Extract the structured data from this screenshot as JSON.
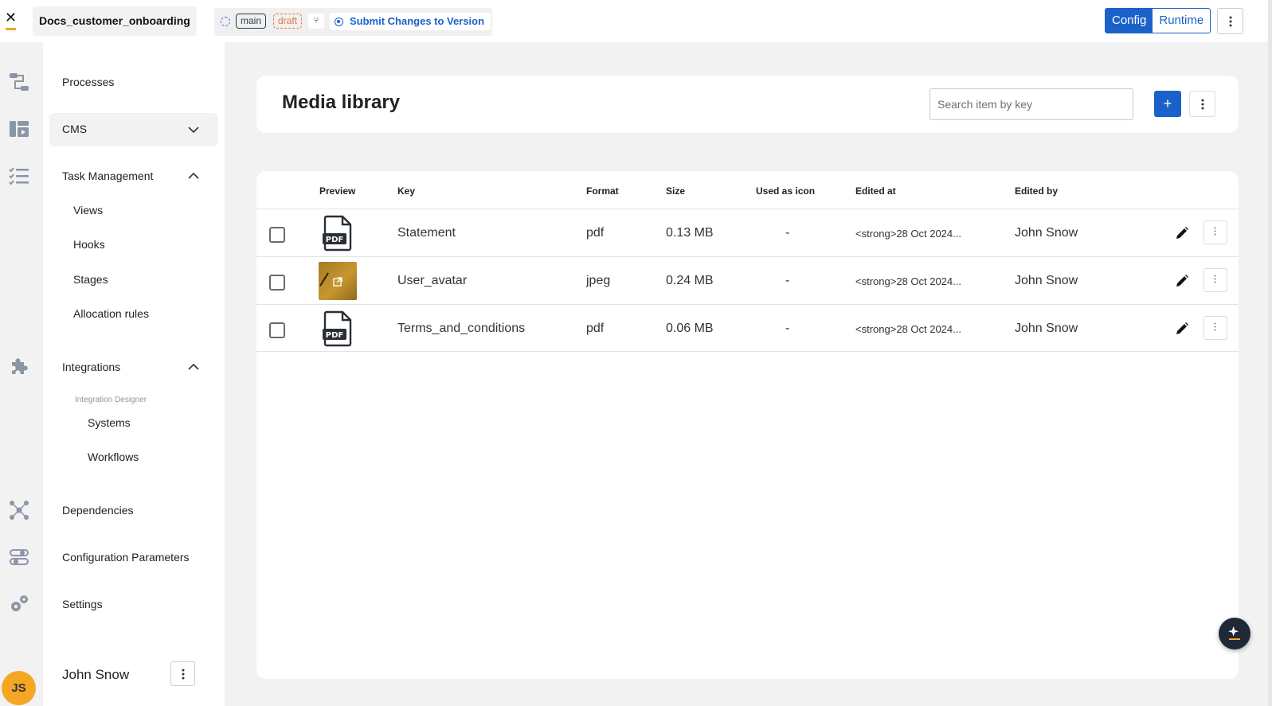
{
  "app": {
    "project_name": "Docs_customer_onboarding",
    "branch": "main",
    "status": "draft",
    "submit_label": "Submit Changes to Version",
    "modes": [
      "Config",
      "Runtime"
    ],
    "active_mode": "Config"
  },
  "rail": {
    "icons": [
      "processes-icon",
      "cms-icon",
      "task-management-icon",
      "integrations-icon",
      "dependencies-icon",
      "configuration-parameters-icon",
      "settings-icon"
    ],
    "avatar_initials": "JS"
  },
  "nav": {
    "processes": "Processes",
    "cms": "CMS",
    "task_management": "Task Management",
    "task_children": [
      "Views",
      "Hooks",
      "Stages",
      "Allocation rules"
    ],
    "integrations": "Integrations",
    "integration_caption": "Integration Designer",
    "integration_children": [
      "Systems",
      "Workflows"
    ],
    "dependencies": "Dependencies",
    "configuration_parameters": "Configuration Parameters",
    "settings": "Settings",
    "user_name": "John Snow"
  },
  "main": {
    "title": "Media library",
    "search_placeholder": "Search item by key",
    "add_label": "+"
  },
  "table": {
    "headers": {
      "preview": "Preview",
      "key": "Key",
      "format": "Format",
      "size": "Size",
      "used_as_icon": "Used as icon",
      "edited_at": "Edited at",
      "edited_by": "Edited by"
    },
    "rows": [
      {
        "preview": "PDF",
        "key": "Statement",
        "format": "pdf",
        "size": "0.13 MB",
        "used_as_icon": "-",
        "edited_at": "<strong>28 Oct 2024...",
        "edited_by": "John Snow"
      },
      {
        "preview": "image",
        "key": "User_avatar",
        "format": "jpeg",
        "size": "0.24 MB",
        "used_as_icon": "-",
        "edited_at": "<strong>28 Oct 2024...",
        "edited_by": "John Snow"
      },
      {
        "preview": "PDF",
        "key": "Terms_and_conditions",
        "format": "pdf",
        "size": "0.06 MB",
        "used_as_icon": "-",
        "edited_at": "<strong>28 Oct 2024...",
        "edited_by": "John Snow"
      }
    ]
  },
  "colors": {
    "accent": "#1a62c9",
    "brand_yellow": "#f5a623",
    "draft": "#e07b39"
  }
}
